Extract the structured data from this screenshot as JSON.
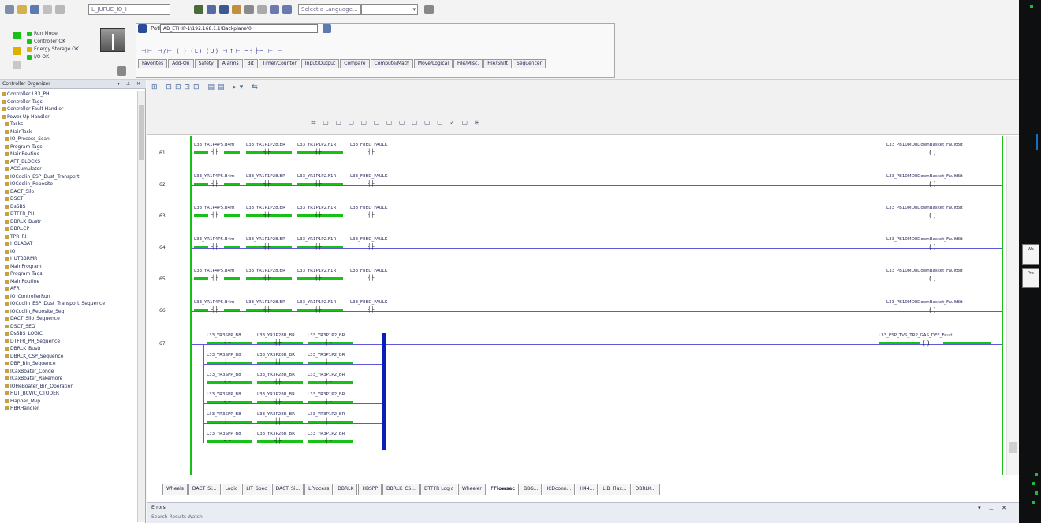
{
  "toolbar": {
    "path_field": "L_JUFUE_IO_I",
    "search_field": "Select a Language...",
    "colors": {
      "accent": "#18c018",
      "branch": "#0a1fb8",
      "rung": "#5b5bd9"
    }
  },
  "controller_status": {
    "rows": [
      {
        "label": "Run Mode",
        "color": "#18c018"
      },
      {
        "label": "Controller OK",
        "color": "#18c018"
      },
      {
        "label": "Energy Storage OK",
        "color": "#e0b000"
      },
      {
        "label": "I/O OK",
        "color": "#18c018"
      }
    ]
  },
  "path_bar": {
    "label": "Path:",
    "value": "AB_ETHIP-1\\192.168.1.1\\Backplane\\0"
  },
  "instruction_tabs": [
    "Favorites",
    "Add-On",
    "Safety",
    "Alarms",
    "Bit",
    "Timer/Counter",
    "Input/Output",
    "Compare",
    "Compute/Math",
    "Move/Logical",
    "File/Misc.",
    "File/Shift",
    "Sequencer"
  ],
  "organizer": {
    "title": "Controller Organizer",
    "items": [
      "Controller L33_PH",
      "Controller Tags",
      "Controller Fault Handler",
      "Power-Up Handler",
      "Tasks",
      "MainTask",
      "IO_Process_Scan",
      "Program Tags",
      "MainRoutine",
      "AFT_BLOCKS",
      "ACCumulator",
      "IOCoolin_ESP_Dust_Transport",
      "IOCoolin_Reposite",
      "DACT_Silo",
      "DSCT",
      "DsSBS",
      "DTFFR_PH",
      "DBRLK_Bustr",
      "DBRLCP",
      "TPR_RH",
      "HOLABAT",
      "IO",
      "HUTBBRMR",
      "MainProgram",
      "Program Tags",
      "MainRoutine",
      "AFR",
      "IO_ControllerRun",
      "IOCoolin_ESP_Dust_Transport_Sequence",
      "IOCoolin_Reposite_Seq",
      "DACT_Silo_Sequence",
      "DSCT_SEQ",
      "DsSBS_LOGIC",
      "DTFFR_PH_Sequence",
      "DBRLK_Bustr",
      "DBRLK_CSP_Sequence",
      "DBP_Bin_Sequence",
      "ICaxBoater_Conde",
      "ICaxBoater_Rakemore",
      "IOHeBoater_Bin_Operation",
      "HUT_BCWC_CTODER",
      "Flapper_Mvp",
      "HBRHandler"
    ]
  },
  "ladder": {
    "rungs": [
      {
        "number": "61",
        "contacts": [
          "L33_YR1P4P5.B4m",
          "L33_YR1P1P28.BR",
          "L33_YR1P1P2.F1R",
          "L33_F8BD_FAULK"
        ],
        "coil": "L33_PB10MOIlDownBasket_FaultBit"
      },
      {
        "number": "62",
        "contacts": [
          "L33_YR1P4P5.B4m",
          "L33_YR1P1P28.BR",
          "L33_YR1P1P2.F1R",
          "L33_F8BD_FAULK"
        ],
        "coil": "L33_PB10MOIlDownBasket_FaultBit"
      },
      {
        "number": "63",
        "contacts": [
          "L33_YR1P4P5.B4m",
          "L33_YR1P1P28.BR",
          "L33_YR1P1P2.F1R",
          "L33_F8BD_FAULK"
        ],
        "coil": "L33_PB10MOIlDownBasket_FaultBit"
      },
      {
        "number": "64",
        "contacts": [
          "L33_YR1P4P5.B4m",
          "L33_YR1P1P28.BR",
          "L33_YR1P1P2.F1R",
          "L33_F8BD_FAULK"
        ],
        "coil": "L33_PB10MOIlDownBasket_FaultBit"
      },
      {
        "number": "65",
        "contacts": [
          "L33_YR1P4P5.B4m",
          "L33_YR1P1P28.BR",
          "L33_YR1P1P2.F1R",
          "L33_F8BD_FAULK"
        ],
        "coil": "L33_PB10MOIlDownBasket_FaultBit"
      },
      {
        "number": "66",
        "contacts": [
          "L33_YR1P4P5.B4m",
          "L33_YR1P1P28.BR",
          "L33_YR1P1P2.F1R",
          "L33_F8BD_FAULK"
        ],
        "coil": "L33_PB10MOIlDownBasket_FaultBit"
      }
    ],
    "branch_rung": {
      "number": "67",
      "coil": "L33_ESP_TVS_TRP_GAS_DEF_Fault",
      "branches": [
        [
          "L33_YR3SPP_B8",
          "L33_YR3P28R_BR",
          "L33_YR3P1P2_BR"
        ],
        [
          "L33_YR3SPP_B8",
          "L33_YR3P28R_BR",
          "L33_YR3P1P2_BR"
        ],
        [
          "L33_YR3SPP_B8",
          "L33_YR3P28R_BR",
          "L33_YR3P1P2_BR"
        ],
        [
          "L33_YR3SPP_B8",
          "L33_YR3P28R_BR",
          "L33_YR3P1P2_BR"
        ],
        [
          "L33_YR3SPP_B8",
          "L33_YR3P28R_BR",
          "L33_YR3P1P2_BR"
        ],
        [
          "L33_YR3SPP_B8",
          "L33_YR3P28R_BR",
          "L33_YR3P1P2_BR"
        ]
      ]
    }
  },
  "routine_tabs": [
    "Wheels",
    "DACT_Si...",
    "Logic",
    "LIT_Spec",
    "DACT_Si...",
    "LProcess",
    "DBRLK",
    "HBSPP",
    "DBRLK_CS...",
    "DTFFR Logic",
    "Wheeler",
    "FFlowsec",
    "BBG...",
    "ICDconn...",
    "H44...",
    "LIB_Flux...",
    "DBRLK..."
  ],
  "routine_tab_active_index": 11,
  "bottom_pane": {
    "title": "Errors",
    "subtitle": "Search Results  Watch"
  },
  "side_buttons": [
    "Wa",
    "Pro"
  ]
}
